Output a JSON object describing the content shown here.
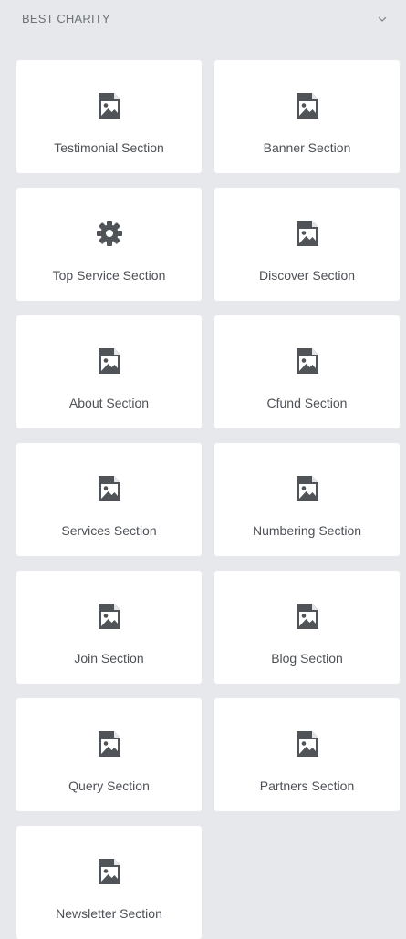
{
  "panel": {
    "title": "BEST CHARITY",
    "toggle_icon": "chevron-down-icon"
  },
  "colors": {
    "background": "#e6e8eb",
    "tile": "#ffffff",
    "icon": "#505459",
    "text": "#4d5157",
    "header_text": "#6f7378"
  },
  "tiles": [
    {
      "label": "Testimonial Section",
      "icon": "image-icon"
    },
    {
      "label": "Banner Section",
      "icon": "image-icon"
    },
    {
      "label": "Top Service Section",
      "icon": "gear-icon"
    },
    {
      "label": "Discover Section",
      "icon": "image-icon"
    },
    {
      "label": "About Section",
      "icon": "image-icon"
    },
    {
      "label": "Cfund Section",
      "icon": "image-icon"
    },
    {
      "label": "Services Section",
      "icon": "image-icon"
    },
    {
      "label": "Numbering Section",
      "icon": "image-icon"
    },
    {
      "label": "Join Section",
      "icon": "image-icon"
    },
    {
      "label": "Blog Section",
      "icon": "image-icon"
    },
    {
      "label": "Query Section",
      "icon": "image-icon"
    },
    {
      "label": "Partners Section",
      "icon": "image-icon"
    },
    {
      "label": "Newsletter Section",
      "icon": "image-icon"
    }
  ]
}
